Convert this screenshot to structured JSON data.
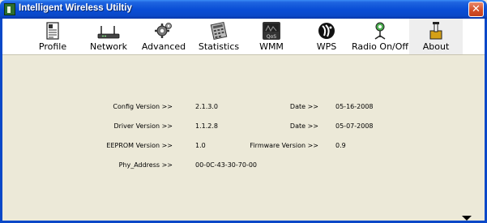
{
  "window": {
    "title": "Intelligent Wireless Utiltiy",
    "close_glyph": "✕"
  },
  "toolbar": {
    "items": [
      {
        "label": "Profile",
        "icon": "profile-icon"
      },
      {
        "label": "Network",
        "icon": "network-icon"
      },
      {
        "label": "Advanced",
        "icon": "advanced-icon"
      },
      {
        "label": "Statistics",
        "icon": "statistics-icon"
      },
      {
        "label": "WMM",
        "icon": "wmm-icon"
      },
      {
        "label": "WPS",
        "icon": "wps-icon"
      },
      {
        "label": "Radio On/Off",
        "icon": "radio-icon"
      },
      {
        "label": "About",
        "icon": "about-icon"
      }
    ],
    "active": "About"
  },
  "about": {
    "config_version_label": "Config Version >>",
    "config_version": "2.1.3.0",
    "config_date_label": "Date >>",
    "config_date": "05-16-2008",
    "driver_version_label": "Driver Version >>",
    "driver_version": "1.1.2.8",
    "driver_date_label": "Date >>",
    "driver_date": "05-07-2008",
    "eeprom_version_label": "EEPROM Version >>",
    "eeprom_version": "1.0",
    "firmware_version_label": "Firmware Version >>",
    "firmware_version": "0.9",
    "phy_address_label": "Phy_Address >>",
    "phy_address": "00-0C-43-30-70-00"
  },
  "colors": {
    "titlebar": "#0a4ed6",
    "background": "#ece9d8",
    "toolbar": "#ffffff",
    "close_button": "#d4502a"
  }
}
